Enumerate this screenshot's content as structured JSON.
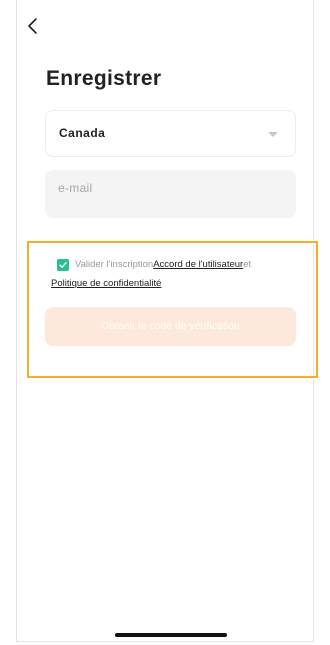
{
  "header": {
    "back_icon": "chevron-left-icon",
    "title": "Enregistrer"
  },
  "form": {
    "country": {
      "selected": "Canada",
      "caret_icon": "caret-down-icon"
    },
    "email": {
      "placeholder": "e-mail",
      "value": ""
    }
  },
  "terms": {
    "checked": true,
    "checkbox_color": "#26c193",
    "prefix": "Valider l'inscription",
    "user_agreement_link": "Accord de l'utilisateur",
    "connector": "et",
    "privacy_policy_link": "Politique de confidentialité"
  },
  "submit": {
    "label": "Obtenir le code de vérification",
    "background": "#fde9db"
  },
  "highlight": {
    "color": "#f4ad2d"
  }
}
